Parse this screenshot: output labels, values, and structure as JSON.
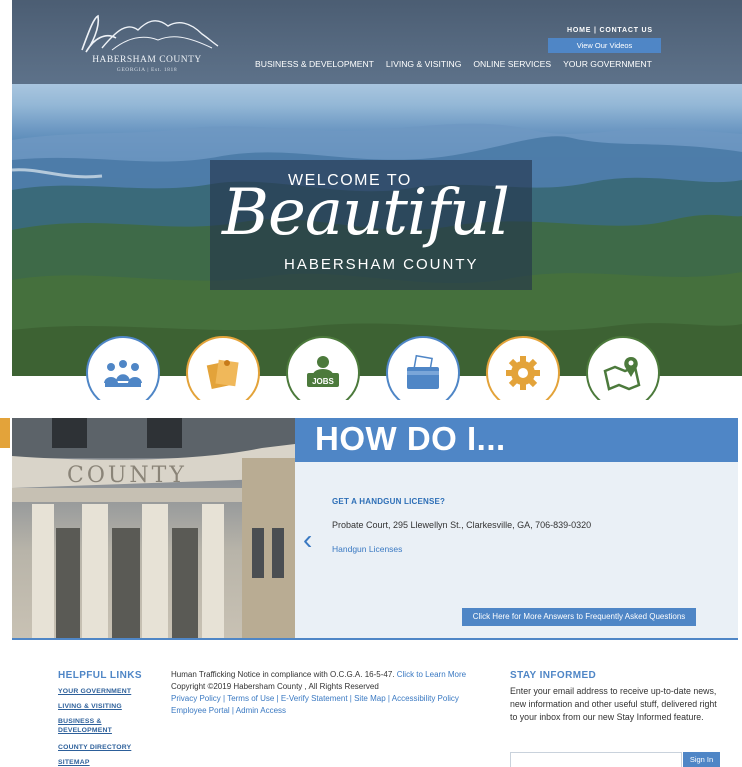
{
  "header": {
    "logo_title": "HABERSHAM COUNTY",
    "logo_subtitle": "GEORGIA | Est. 1818",
    "utility_links": [
      "HOME",
      "CONTACT US"
    ],
    "utility_separator": "|",
    "videos_button": "View Our Videos",
    "nav": [
      "BUSINESS & DEVELOPMENT",
      "LIVING & VISITING",
      "ONLINE SERVICES",
      "YOUR GOVERNMENT"
    ]
  },
  "hero": {
    "welcome_to": "WELCOME TO",
    "welcome_big": "Beautiful",
    "welcome_bottom": "HABERSHAM COUNTY"
  },
  "quick_links": [
    {
      "icon": "meeting-people-icon",
      "border": "#4f86c6"
    },
    {
      "icon": "notice-board-icon",
      "border": "#e3a33a"
    },
    {
      "icon": "jobs-icon",
      "border": "#4c7a3c",
      "label": "JOBS"
    },
    {
      "icon": "payment-wallet-icon",
      "border": "#4f86c6"
    },
    {
      "icon": "gear-icon",
      "border": "#e3a33a"
    },
    {
      "icon": "map-pin-icon",
      "border": "#4c7a3c"
    }
  ],
  "howdoi": {
    "title": "HOW DO I...",
    "building_text": "COUNTY",
    "question": "GET A HANDGUN LICENSE?",
    "answer": "Probate Court, 295 Llewellyn St., Clarkesville, GA, 706-839-0320",
    "link": "Handgun Licenses",
    "more_button": "Click Here for More Answers to Frequently Asked Questions"
  },
  "footer": {
    "helpful_title": "HELPFUL LINKS",
    "helpful_links": [
      "YOUR GOVERNMENT",
      "LIVING & VISITING",
      "BUSINESS &",
      "DEVELOPMENT",
      "COUNTY DIRECTORY",
      "SITEMAP"
    ],
    "notice_text": "Human Trafficking Notice in compliance with O.C.G.A. 16-5-47.",
    "notice_link": "Click to Learn More",
    "copyright": "Copyright ©2019 Habersham County , All Rights Reserved",
    "links_row1": [
      "Privacy Policy",
      "Terms of Use",
      "E-Verify Statement",
      "Site Map",
      "Accessibility Policy"
    ],
    "links_row2": [
      "Employee Portal",
      "Admin Access"
    ],
    "link_separator": " | ",
    "stay_title": "STAY INFORMED",
    "stay_text": "Enter your email address to receive up-to-date news, new information and other useful stuff, delivered right to your inbox from our new Stay Informed feature.",
    "email_placeholder": "",
    "signin_button": "Sign In"
  },
  "colors": {
    "accent_blue": "#4f86c6",
    "accent_orange": "#e3a33a",
    "accent_green": "#4c7a3c",
    "header_bg": "#566a82"
  }
}
